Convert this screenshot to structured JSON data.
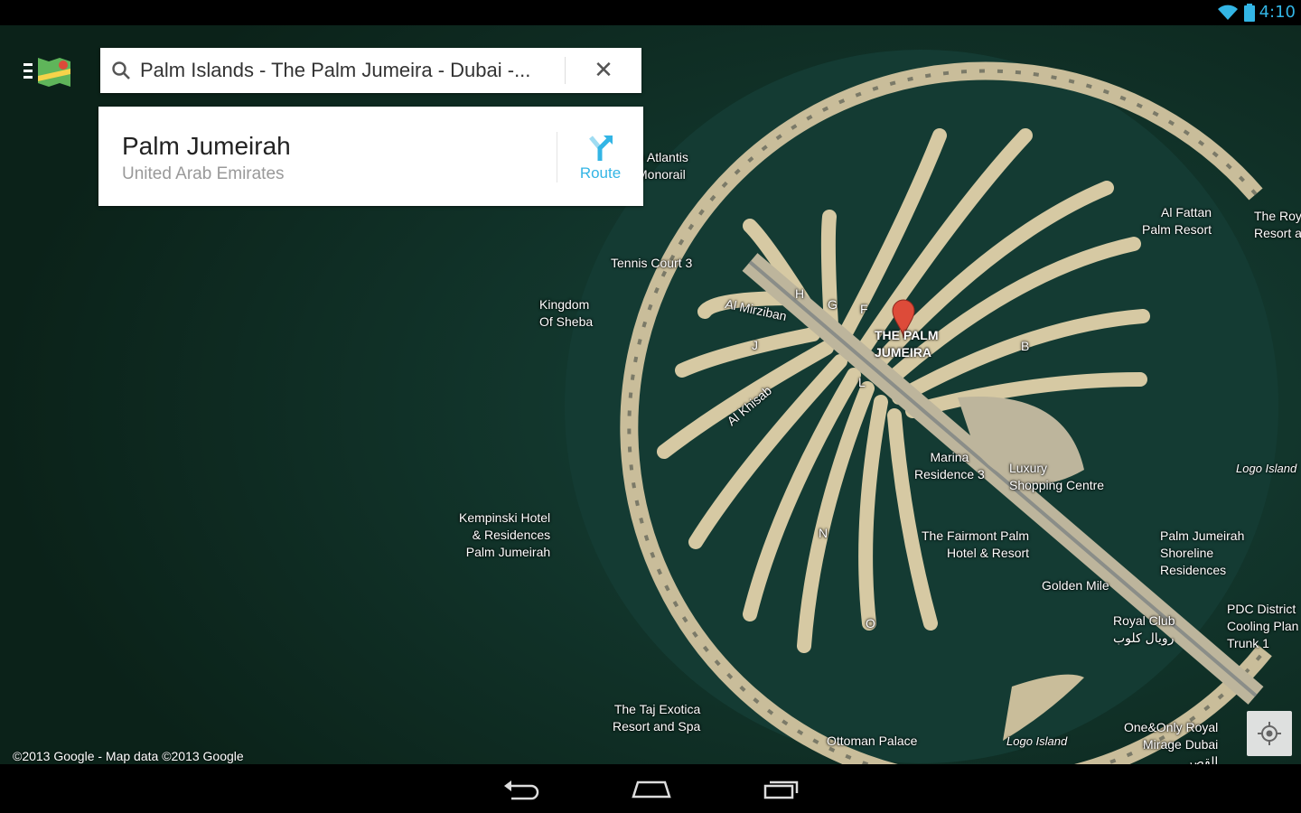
{
  "status": {
    "time": "4:10",
    "icons": [
      "wifi-icon",
      "battery-icon"
    ]
  },
  "search": {
    "query": "Palm Islands - The Palm Jumeira - Dubai -...",
    "icon": "search-icon",
    "clear_icon": "close-icon"
  },
  "place": {
    "title": "Palm Jumeirah",
    "subtitle": "United Arab Emirates",
    "route_label": "Route"
  },
  "map": {
    "copyright": "©2013 Google - Map data ©2013 Google",
    "pin_label": "THE PALM\nJUMEIRA",
    "labels": [
      "n Atlantis\nMonorail",
      "Tennis Court 3",
      "Kingdom\nOf Sheba",
      "Al Mirziban",
      "Al Khisab",
      "Marina\nResidence 3",
      "Luxury\nShopping Centre",
      "Al Fattan\nPalm Resort",
      "The Roy\nResort a",
      "Logo Island",
      "Kempinski Hotel\n& Residences\nPalm Jumeirah",
      "The Fairmont Palm\nHotel & Resort",
      "Palm Jumeirah\nShoreline\nResidences",
      "Golden Mile",
      "PDC District\nCooling Plan\nTrunk 1",
      "Royal Club\nرويال كلوب",
      "The Taj Exotica\nResort and Spa",
      "Ottoman Palace",
      "Logo Island",
      "One&Only Royal\nMirage Dubai\nالقصر"
    ],
    "frond_letters": [
      "H",
      "G",
      "F",
      "J",
      "B",
      "L",
      "N",
      "O"
    ]
  },
  "nav": {
    "buttons": [
      "back",
      "home",
      "recents"
    ]
  }
}
